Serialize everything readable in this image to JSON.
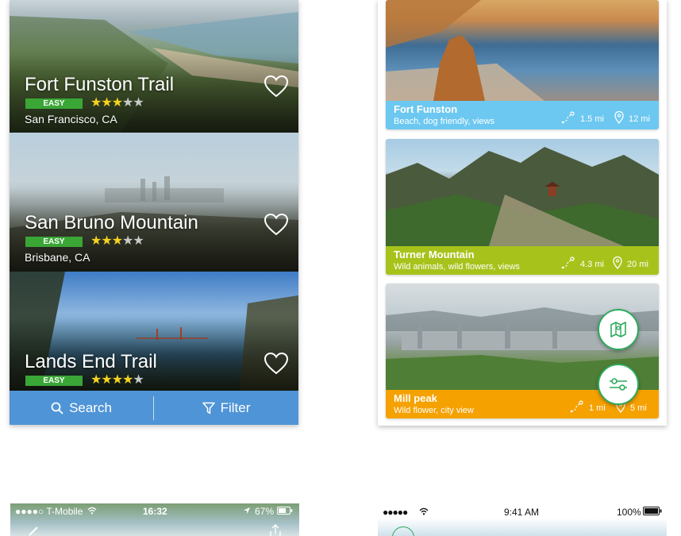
{
  "trails": [
    {
      "name": "Fort Funston Trail",
      "difficulty": "EASY",
      "rating": 3,
      "max_rating": 5,
      "location": "San Francisco, CA",
      "icon": "heart-icon"
    },
    {
      "name": "San Bruno Mountain",
      "difficulty": "EASY",
      "rating": 3,
      "max_rating": 5,
      "location": "Brisbane, CA",
      "icon": "heart-icon"
    },
    {
      "name": "Lands End Trail",
      "difficulty": "EASY",
      "rating": 4,
      "max_rating": 5,
      "location": "",
      "icon": "heart-icon"
    }
  ],
  "bottom_bar": {
    "search_label": "Search",
    "search_icon": "search-icon",
    "filter_label": "Filter",
    "filter_icon": "filter-icon",
    "color": "#4f94d6"
  },
  "hikes": [
    {
      "name": "Fort Funston",
      "tags": "Beach, dog friendly, views",
      "length": "1.5 mi",
      "distance": "12 mi",
      "color": "#6cc8f0"
    },
    {
      "name": "Turner Mountain",
      "tags": "Wild animals, wild flowers, views",
      "length": "4.3 mi",
      "distance": "20 mi",
      "color": "#a7c31b"
    },
    {
      "name": "Mill peak",
      "tags": "Wild flower, city view",
      "length": "1 mi",
      "distance": "5 mi",
      "color": "#f5a100"
    }
  ],
  "fabs": {
    "map_icon": "map-icon",
    "filter_icon": "sliders-icon",
    "accent": "#2eaa5c"
  },
  "status_bar_left": {
    "carrier": "●●●●○ T-Mobile",
    "time": "16:32",
    "battery": "67%"
  },
  "status_bar_right": {
    "signal": "●●●●●",
    "time": "9:41 AM",
    "battery": "100%"
  }
}
